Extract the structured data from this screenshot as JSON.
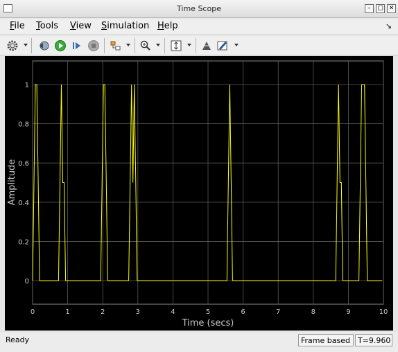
{
  "window": {
    "title": "Time Scope"
  },
  "menu": {
    "items": [
      {
        "label": "File",
        "underline": "F",
        "rest": "ile"
      },
      {
        "label": "Tools",
        "underline": "T",
        "rest": "ools"
      },
      {
        "label": "View",
        "underline": "V",
        "rest": "iew"
      },
      {
        "label": "Simulation",
        "underline": "S",
        "rest": "imulation"
      },
      {
        "label": "Help",
        "underline": "H",
        "rest": "elp"
      }
    ]
  },
  "toolbar": {
    "icons": [
      "gear-icon",
      "back-icon",
      "run-icon",
      "step-icon",
      "stop-icon",
      "highlight-icon",
      "zoom-icon",
      "autoscale-icon",
      "signal-icon",
      "style-icon"
    ]
  },
  "status": {
    "left": "Ready",
    "frame_mode": "Frame based",
    "time": "T=9.960"
  },
  "chart_data": {
    "type": "line",
    "xlabel": "Time (secs)",
    "ylabel": "Amplitude",
    "xlim": [
      0,
      10
    ],
    "ylim": [
      -0.12,
      1.12
    ],
    "x_ticks": [
      0,
      1,
      2,
      3,
      4,
      5,
      6,
      7,
      8,
      9,
      10
    ],
    "x_tick_labels": [
      "0",
      "1",
      "2",
      "3",
      "4",
      "5",
      "6",
      "7",
      "8",
      "9",
      "10"
    ],
    "y_ticks": [
      0,
      0.2,
      0.4,
      0.6,
      0.8,
      1
    ],
    "y_tick_labels": [
      "0",
      "0.2",
      "0.4",
      "0.6",
      "0.8",
      "1"
    ],
    "grid": true,
    "background": "#000000",
    "line_color": "#ffff00",
    "grid_color": "#5a5a5a",
    "series": [
      {
        "x": [
          0,
          0.04,
          0.08,
          0.12,
          0.16,
          0.2,
          0.24,
          0.74,
          0.78,
          0.82,
          0.86,
          0.9,
          0.94,
          0.98,
          1.94,
          1.98,
          2.02,
          2.06,
          2.1,
          2.14,
          2.18,
          2.74,
          2.78,
          2.82,
          2.86,
          2.9,
          2.94,
          2.98,
          3.02,
          5.54,
          5.58,
          5.62,
          5.66,
          5.7,
          5.74,
          5.78,
          8.64,
          8.68,
          8.72,
          8.76,
          8.8,
          8.84,
          8.88,
          9.3,
          9.34,
          9.38,
          9.42,
          9.46,
          9.5,
          9.54,
          9.58,
          9.62,
          9.66,
          9.7,
          9.74,
          9.96
        ],
        "y": [
          0,
          0.5,
          1,
          1,
          0.5,
          0,
          0,
          0,
          0.5,
          1,
          0.5,
          0.5,
          0,
          0,
          0,
          0.5,
          1,
          1,
          0.5,
          0,
          0,
          0,
          0.5,
          1,
          0.5,
          1,
          0.5,
          0,
          0,
          0,
          0.5,
          1,
          0.5,
          0,
          0,
          0,
          0,
          0.5,
          1,
          0.5,
          0.5,
          0,
          0,
          0,
          0.5,
          1,
          1,
          1,
          0.5,
          0,
          0,
          0,
          0,
          0,
          0,
          0
        ]
      }
    ]
  }
}
